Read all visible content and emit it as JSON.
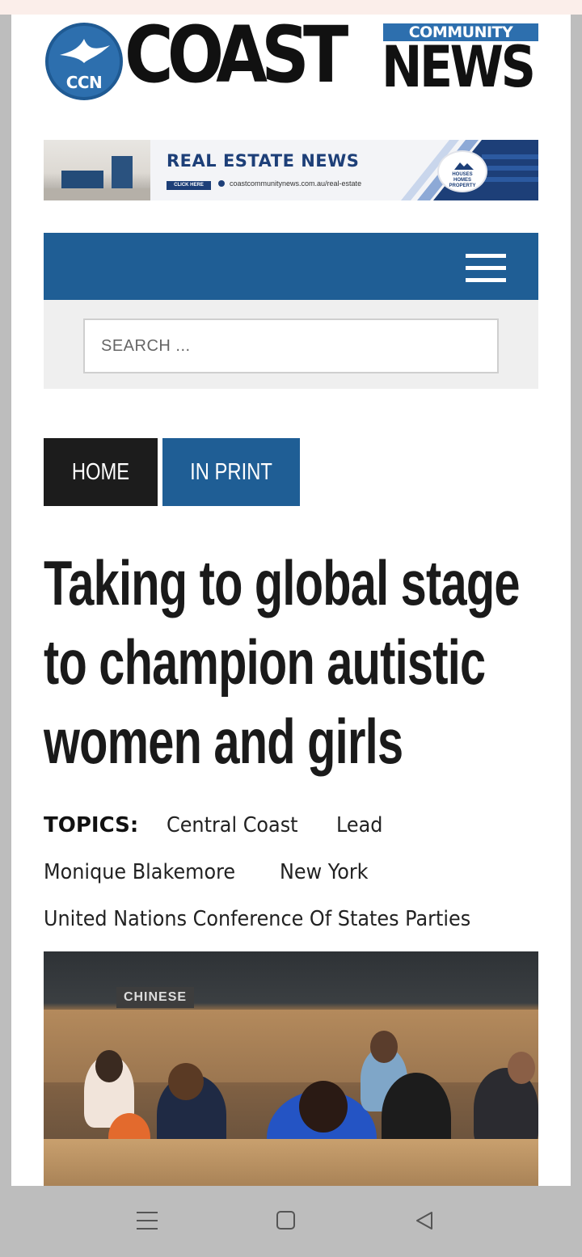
{
  "logo": {
    "badge_text": "CCN",
    "word_main": "COAST",
    "word_top": "COMMUNITY",
    "word_bottom": "NEWS"
  },
  "banner": {
    "title": "REAL ESTATE NEWS",
    "cta": "CLICK HERE",
    "url": "coastcommunitynews.com.au/real-estate",
    "badge_lines": [
      "HOUSES",
      "HOMES",
      "PROPERTY"
    ]
  },
  "nav": {
    "menu_icon": "hamburger-menu-icon"
  },
  "search": {
    "placeholder": "SEARCH ..."
  },
  "breadcrumbs": {
    "home": "HOME",
    "section": "IN PRINT"
  },
  "article": {
    "title_lines": [
      "Taking to global stage",
      "to champion autistic",
      "women and girls"
    ],
    "topics_label": "TOPICS:",
    "topics": [
      "Central Coast",
      "Lead",
      "Monique Blakemore",
      "New York",
      "United Nations Conference Of States Parties"
    ],
    "photo": {
      "sign_text": "CHINESE"
    }
  },
  "colors": {
    "brand_blue": "#1f5e95",
    "dark": "#1c1c1c",
    "search_bg": "#efefef"
  },
  "system_nav": {
    "icons": [
      "recents-icon",
      "home-icon",
      "back-icon"
    ]
  }
}
